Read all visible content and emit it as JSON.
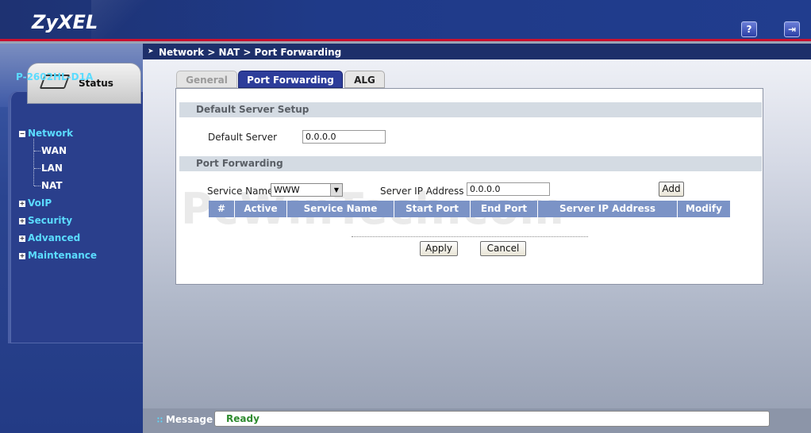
{
  "brand": {
    "logo": "ZyXEL"
  },
  "header": {
    "help_icon": "?",
    "logout_icon": "⇥"
  },
  "sidebar": {
    "status_tab": "Status",
    "device_name": "P-2602HL-D1A",
    "items": [
      {
        "label": "Network",
        "expander": "−"
      },
      {
        "label": "WAN"
      },
      {
        "label": "LAN"
      },
      {
        "label": "NAT"
      },
      {
        "label": "VoIP",
        "expander": "+"
      },
      {
        "label": "Security",
        "expander": "+"
      },
      {
        "label": "Advanced",
        "expander": "+"
      },
      {
        "label": "Maintenance",
        "expander": "+"
      }
    ]
  },
  "breadcrumb": "Network > NAT > Port Forwarding",
  "tabs": [
    {
      "label": "General",
      "state": "disabled"
    },
    {
      "label": "Port Forwarding",
      "state": "active"
    },
    {
      "label": "ALG",
      "state": "normal"
    }
  ],
  "default_server": {
    "section_title": "Default Server Setup",
    "label": "Default Server",
    "value": "0.0.0.0"
  },
  "port_forwarding": {
    "section_title": "Port Forwarding",
    "service_name_label": "Service Name",
    "service_name_value": "WWW",
    "server_ip_label": "Server IP Address",
    "server_ip_value": "0.0.0.0",
    "add_label": "Add",
    "columns": [
      "#",
      "Active",
      "Service Name",
      "Start Port",
      "End Port",
      "Server IP Address",
      "Modify"
    ]
  },
  "actions": {
    "apply": "Apply",
    "cancel": "Cancel"
  },
  "watermark": "PcWinTech.com",
  "status_bar": {
    "label": "Message",
    "text": "Ready"
  },
  "colors": {
    "header": "#1f3a88",
    "accent_red": "#c8102e",
    "nav_link": "#5bdcff",
    "active_tab": "#2d3d9a",
    "table_header": "#7b93c6",
    "ready": "#2e8b2e"
  }
}
